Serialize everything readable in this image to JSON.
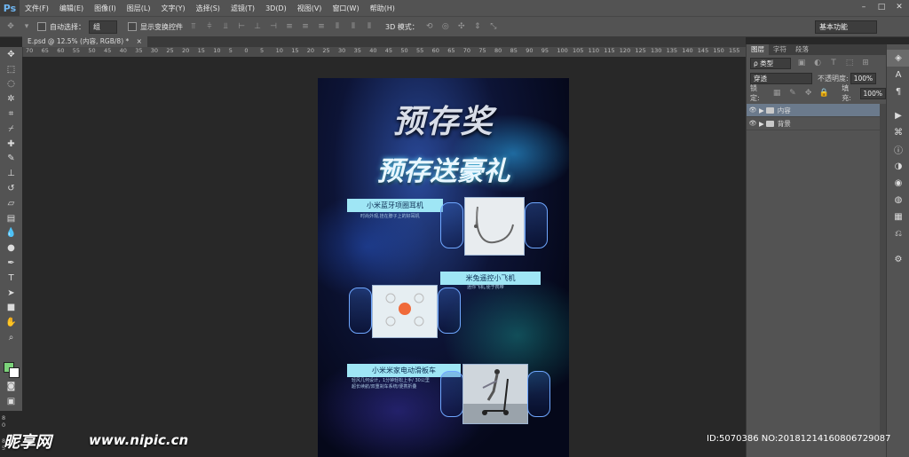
{
  "app": {
    "logo": "Ps"
  },
  "menu": [
    "文件(F)",
    "编辑(E)",
    "图像(I)",
    "图层(L)",
    "文字(Y)",
    "选择(S)",
    "滤镜(T)",
    "3D(D)",
    "视图(V)",
    "窗口(W)",
    "帮助(H)"
  ],
  "window_controls": [
    "–",
    "□",
    "✕"
  ],
  "options": {
    "auto_select_label": "自动选择：",
    "auto_select_value": "组",
    "show_transform_label": "显示变换控件",
    "mode_3d_label": "3D 模式：",
    "workspace": "基本功能"
  },
  "document_tab": {
    "title": "E.psd @ 12.5% (内容, RGB/8) *",
    "close": "×"
  },
  "ruler_labels": [
    "70",
    "65",
    "60",
    "55",
    "50",
    "45",
    "40",
    "35",
    "30",
    "25",
    "20",
    "15",
    "10",
    "5",
    "0",
    "5",
    "10",
    "15",
    "20",
    "25",
    "30",
    "35",
    "40",
    "45",
    "50",
    "55",
    "60",
    "65",
    "70",
    "75",
    "80",
    "85",
    "90",
    "95",
    "100",
    "105",
    "110",
    "115",
    "120",
    "125",
    "130",
    "135",
    "140",
    "145",
    "150",
    "155"
  ],
  "vruler_labels": [
    "8",
    "0",
    "8",
    "5"
  ],
  "poster": {
    "title1": "预存奖",
    "title2": "预存送豪礼",
    "products": [
      {
        "name": "小米蓝牙项圈耳机",
        "desc": "时尚外观,挂在脖子上的好耳机"
      },
      {
        "name": "米兔遥控小飞机",
        "desc": "迷你飞机,便于携带"
      },
      {
        "name": "小米米家电动滑板车",
        "desc1": "轻风几何设计，1分钟轻松上手/ 30公里",
        "desc2": "超长续航/双重刹车系统/便携折叠"
      }
    ]
  },
  "panel": {
    "tabs": [
      "图层",
      "字符",
      "段落"
    ],
    "filter_label": "ρ 类型",
    "blend_mode": "穿透",
    "opacity_label": "不透明度:",
    "opacity_value": "100%",
    "lock_label": "锁定:",
    "fill_label": "填充:",
    "fill_value": "100%",
    "layers": [
      {
        "name": "内容",
        "selected": true
      },
      {
        "name": "背景",
        "selected": false
      }
    ]
  },
  "watermark": {
    "logo": "昵享网",
    "url": "www.nipic.cn",
    "id": "ID:5070386 NO:20181214160806729087"
  }
}
